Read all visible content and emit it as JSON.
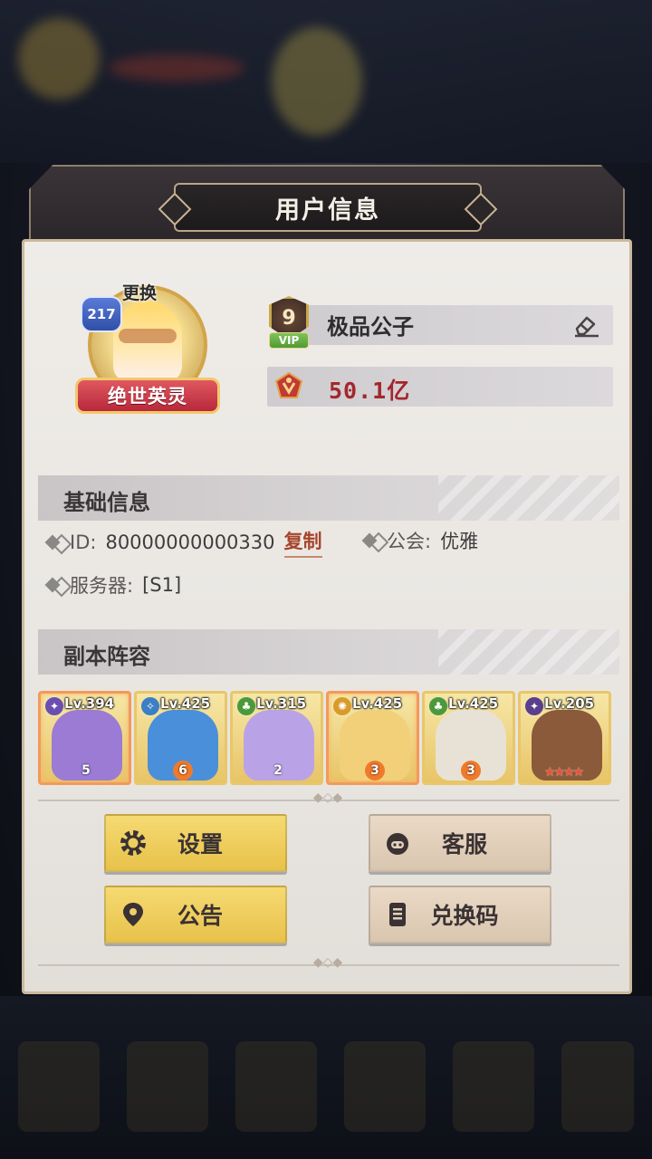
{
  "modal": {
    "title": "用户信息"
  },
  "profile": {
    "level": "217",
    "change_label": "更换",
    "title_badge": "绝世英灵",
    "vip_level": "9",
    "vip_label": "VIP",
    "name": "极品公子",
    "power": "50.1亿"
  },
  "basic_info": {
    "heading": "基础信息",
    "id_label": "ID:",
    "id_value": "80000000000330",
    "copy_label": "复制",
    "guild_label": "公会:",
    "guild_value": "优雅",
    "server_label": "服务器:",
    "server_value": "[S1]"
  },
  "lineup": {
    "heading": "副本阵容",
    "heroes": [
      {
        "level": "Lv.394",
        "stars": "5",
        "element_color": "#6b4fb0",
        "art_color": "#9b7bd4"
      },
      {
        "level": "Lv.425",
        "stars": "6",
        "element_color": "#3b7fc4",
        "art_color": "#4a8fd9"
      },
      {
        "level": "Lv.315",
        "stars": "2",
        "element_color": "#4a9a3c",
        "art_color": "#b9a3e6"
      },
      {
        "level": "Lv.425",
        "stars": "3",
        "element_color": "#d89a2a",
        "art_color": "#f2d07a"
      },
      {
        "level": "Lv.425",
        "stars": "3",
        "element_color": "#4a9a3c",
        "art_color": "#e8e2d6"
      },
      {
        "level": "Lv.205",
        "stars": "★★★★",
        "element_color": "#5a3f8c",
        "art_color": "#8a5a3a"
      }
    ]
  },
  "actions": {
    "settings": "设置",
    "support": "客服",
    "notice": "公告",
    "redeem": "兑换码"
  },
  "icons": {
    "settings": "gear-icon",
    "support": "headset-icon",
    "notice": "location-pin-icon",
    "redeem": "book-icon",
    "edit": "eraser-edit-icon",
    "power": "power-crest-icon"
  }
}
